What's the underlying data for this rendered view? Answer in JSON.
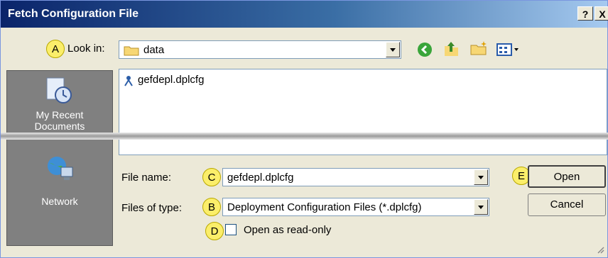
{
  "window": {
    "title": "Fetch Configuration File",
    "help_label": "?",
    "close_label": "X"
  },
  "markers": {
    "a": "A",
    "b": "B",
    "c": "C",
    "d": "D",
    "e": "E"
  },
  "look_in": {
    "label": "Look in:",
    "value": "data"
  },
  "toolbar": {
    "icons": [
      "back-icon",
      "up-folder-icon",
      "new-folder-icon",
      "view-menu-icon"
    ]
  },
  "places": [
    {
      "label_line1": "My Recent",
      "label_line2": "Documents",
      "icon": "recent-documents-icon"
    },
    {
      "label": "Network",
      "icon": "network-icon"
    }
  ],
  "files": [
    {
      "name": "gefdepl.dplcfg",
      "icon": "config-file-icon"
    }
  ],
  "file_name": {
    "label": "File name:",
    "value": "gefdepl.dplcfg"
  },
  "file_type": {
    "label": "Files of type:",
    "value": "Deployment Configuration Files (*.dplcfg)"
  },
  "read_only": {
    "label": "Open as read-only",
    "checked": false
  },
  "buttons": {
    "open": "Open",
    "cancel": "Cancel"
  },
  "colors": {
    "title_start": "#0a246a",
    "title_end": "#a6caf0",
    "marker": "#fbee6a",
    "places_bg": "#808080"
  }
}
